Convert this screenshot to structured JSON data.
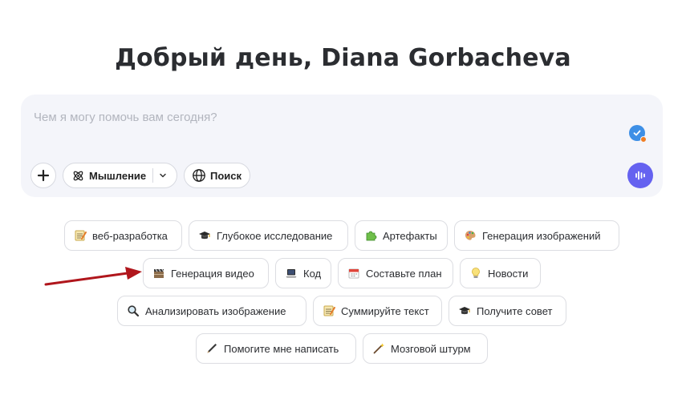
{
  "greeting": "Добрый день, Diana Gorbacheva",
  "composer": {
    "placeholder": "Чем я могу помочь вам сегодня?",
    "thinking_label": "Мышление",
    "search_label": "Поиск"
  },
  "suggestions": [
    {
      "label": "веб-разработка",
      "icon": "memo-icon"
    },
    {
      "label": "Глубокое исследование",
      "icon": "graduation-cap-icon"
    },
    {
      "label": "Артефакты",
      "icon": "puzzle-icon"
    },
    {
      "label": "Генерация изображений",
      "icon": "palette-icon"
    },
    {
      "label": "Генерация видео",
      "icon": "clapper-icon"
    },
    {
      "label": "Код",
      "icon": "laptop-icon"
    },
    {
      "label": "Составьте план",
      "icon": "calendar-icon"
    },
    {
      "label": "Новости",
      "icon": "lightbulb-icon"
    },
    {
      "label": "Анализировать изображение",
      "icon": "magnifier-icon"
    },
    {
      "label": "Суммируйте текст",
      "icon": "memo-icon"
    },
    {
      "label": "Получите совет",
      "icon": "graduation-cap-icon"
    },
    {
      "label": "Помогите мне написать",
      "icon": "pen-icon"
    },
    {
      "label": "Мозговой штурм",
      "icon": "magic-wand-icon"
    }
  ],
  "colors": {
    "accent": "#6562f0",
    "composer_bg": "#f4f5fa",
    "annotation_arrow": "#b0161c"
  }
}
